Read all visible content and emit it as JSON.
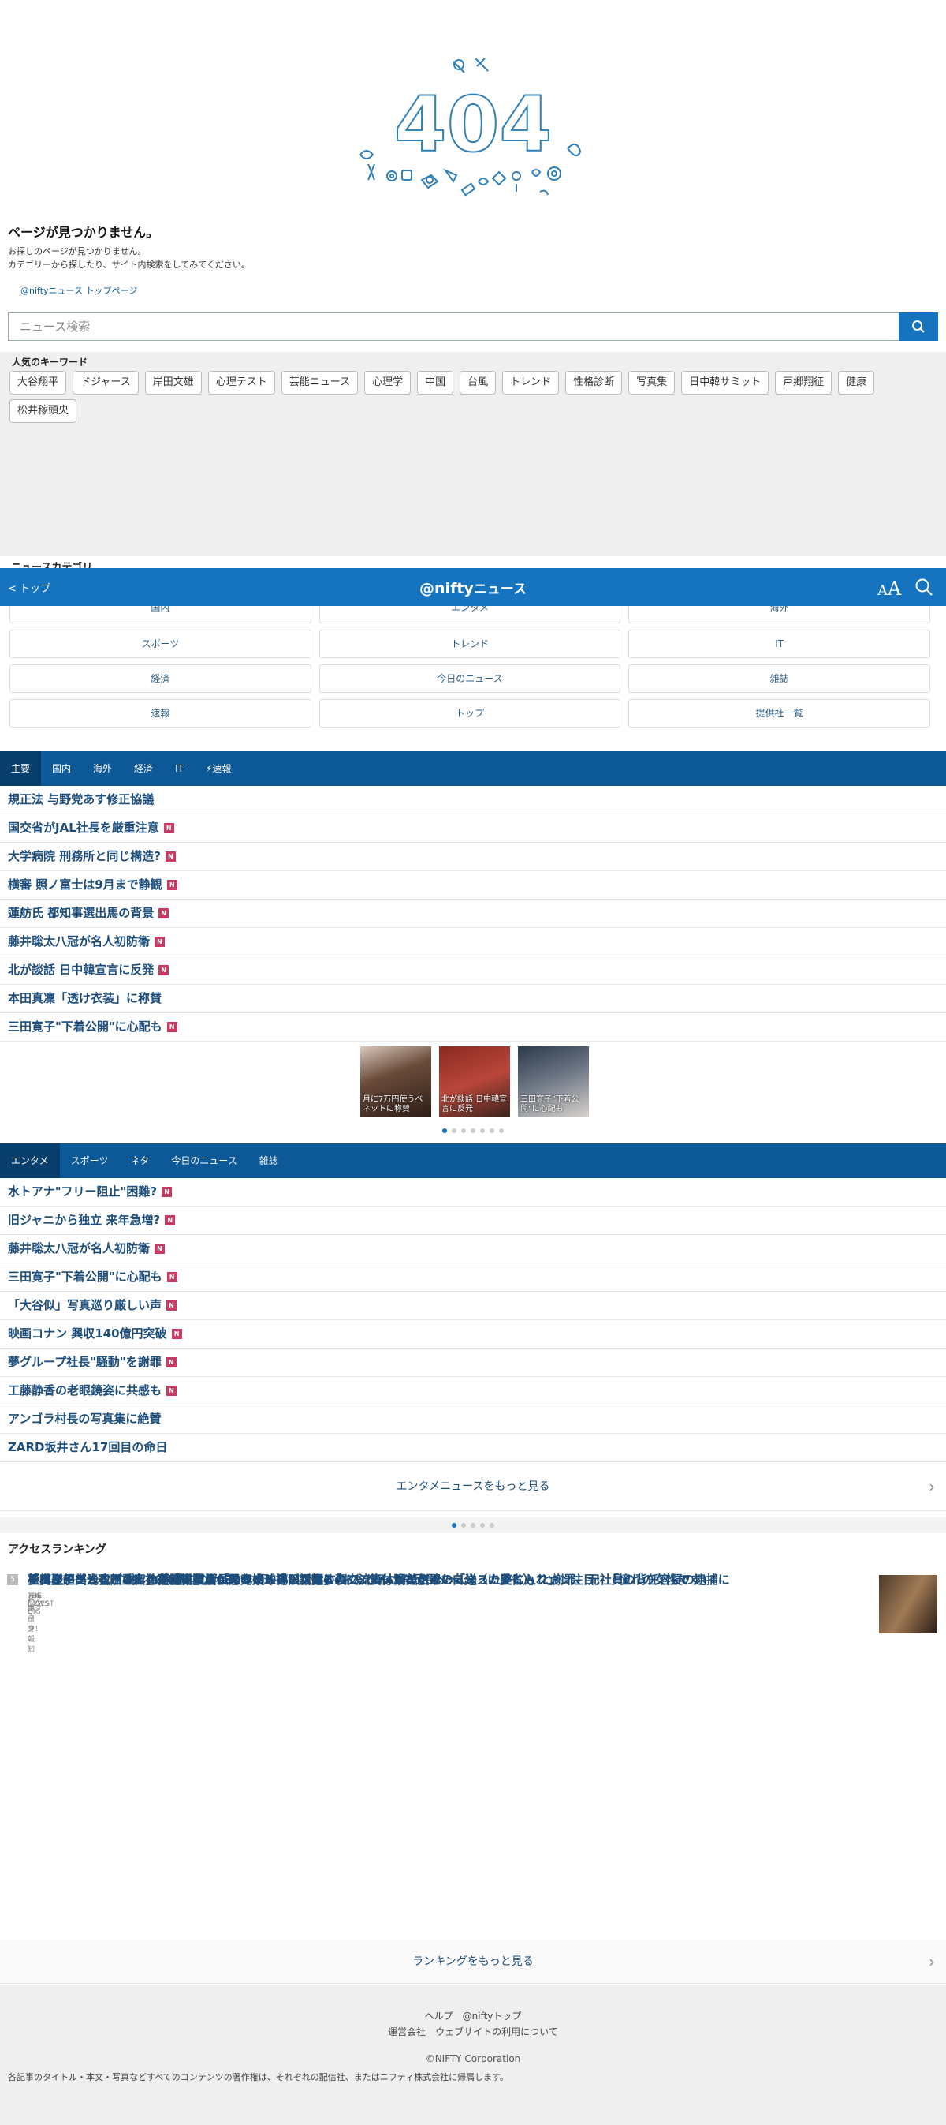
{
  "error_page": {
    "code": "404",
    "title": "ページが見つかりません。",
    "desc_line1": "お探しのページが見つかりません。",
    "desc_line2": "カテゴリーから探したり、サイト内検索をしてみてください。",
    "top_link": "@niftyニュース トップページ"
  },
  "search": {
    "placeholder": "ニュース検索"
  },
  "keywords": {
    "heading": "人気のキーワード",
    "items": [
      "大谷翔平",
      "ドジャース",
      "岸田文雄",
      "心理テスト",
      "芸能ニュース",
      "心理学",
      "中国",
      "台風",
      "トレンド",
      "性格診断",
      "写真集",
      "日中韓サミット",
      "戸郷翔征",
      "健康",
      "松井稼頭央"
    ]
  },
  "category_heading_partial": "ニュースカテゴリ",
  "header": {
    "back_label": "トップ",
    "logo_main": "@nifty",
    "logo_sub": "ニュース",
    "font_size_icon": "font-size-icon",
    "search_icon": "search-icon",
    "accent": "#1673c0"
  },
  "categories": {
    "partial_row": [
      "国内",
      "エンタメ",
      "海外"
    ],
    "rows": [
      "スポーツ",
      "トレンド",
      "IT",
      "経済",
      "今日のニュース",
      "雑誌",
      "速報",
      "トップ",
      "提供社一覧"
    ]
  },
  "main_news": {
    "tabs": [
      "主要",
      "国内",
      "海外",
      "経済",
      "IT",
      "⚡速報"
    ],
    "items": [
      {
        "title": "規正法 与野党あす修正協議",
        "new": false
      },
      {
        "title": "国交省がJAL社長を厳重注意",
        "new": true
      },
      {
        "title": "大学病院 刑務所と同じ構造?",
        "new": true
      },
      {
        "title": "横審 照ノ富士は9月まで静観",
        "new": true
      },
      {
        "title": "蓮舫氏 都知事選出馬の背景",
        "new": true
      },
      {
        "title": "藤井聡太八冠が名人初防衛",
        "new": true
      },
      {
        "title": "北が談話 日中韓宣言に反発",
        "new": true
      },
      {
        "title": "本田真凜「透け衣装」に称賛",
        "new": false
      },
      {
        "title": "三田寛子\"下着公開\"に心配も",
        "new": true
      }
    ],
    "new_badge": "N",
    "thumbs": [
      {
        "caption": "月に7万円使うベネットに称賛"
      },
      {
        "caption": "北が談話 日中韓宣言に反発"
      },
      {
        "caption": "三田寛子\"下着公開\"に心配も"
      }
    ]
  },
  "ent_news": {
    "tabs": [
      "エンタメ",
      "スポーツ",
      "ネタ",
      "今日のニュース",
      "雑誌"
    ],
    "items": [
      {
        "title": "水トアナ\"フリー阻止\"困難?",
        "new": true
      },
      {
        "title": "旧ジャニから独立 来年急増?",
        "new": true
      },
      {
        "title": "藤井聡太八冠が名人初防衛",
        "new": true
      },
      {
        "title": "三田寛子\"下着公開\"に心配も",
        "new": true
      },
      {
        "title": "「大谷似」写真巡り厳しい声",
        "new": true
      },
      {
        "title": "映画コナン 興収140億円突破",
        "new": true
      },
      {
        "title": "夢グループ社長\"騒動\"を謝罪",
        "new": true
      },
      {
        "title": "工藤静香の老眼鏡姿に共感も",
        "new": true
      },
      {
        "title": "アンゴラ村長の写真集に絶賛",
        "new": false
      },
      {
        "title": "ZARD坂井さん17回目の命日",
        "new": false
      }
    ],
    "more": "エンタメニュースをもっと見る"
  },
  "ranking": {
    "heading": "アクセスランキング",
    "items": [
      {
        "rank": "1",
        "title": "王林、超ミニ丈パンツの美脚に反響「スタイルいいなぁ」「おおりんさん足長〜〜い」",
        "source": "クランクイン！"
      },
      {
        "rank": "2",
        "title": "松田聖子　沙也加さん急逝後に復活した元夫・神田正輝との交流…体調を気遣い「送った差し入れ」",
        "source": "女性自身"
      },
      {
        "rank": "3",
        "title": "「奥様、美しすぎる！」菊池雄星、長男の始球式が話題の裏で…妻・瑠美さんのミニスカ姿にもファン注目！「憧れの女性です」",
        "source": "THE DIGEST"
      },
      {
        "rank": "4",
        "title": "トヨタや出光など4社　CN燃料の2030年頃の導入目指す",
        "source": "TBS NEWS DIG"
      },
      {
        "rank": "5",
        "title": "夢グループ・石田重廣社長「従業員が悪いことをしているのに、気付かなかった自分（に反省）」と謝罪、元社員の背任容疑の逮捕に",
        "source": "スポーツ報知"
      }
    ],
    "more": "ランキングをもっと見る"
  },
  "footer": {
    "links_row1": [
      "ヘルプ",
      "@niftyトップ"
    ],
    "links_row2": [
      "運営会社",
      "ウェブサイトの利用について"
    ],
    "copyright": "©NIFTY Corporation",
    "note": "各記事のタイトル・本文・写真などすべてのコンテンツの著作権は、それぞれの配信社、またはニフティ株式会社に帰属します。"
  }
}
